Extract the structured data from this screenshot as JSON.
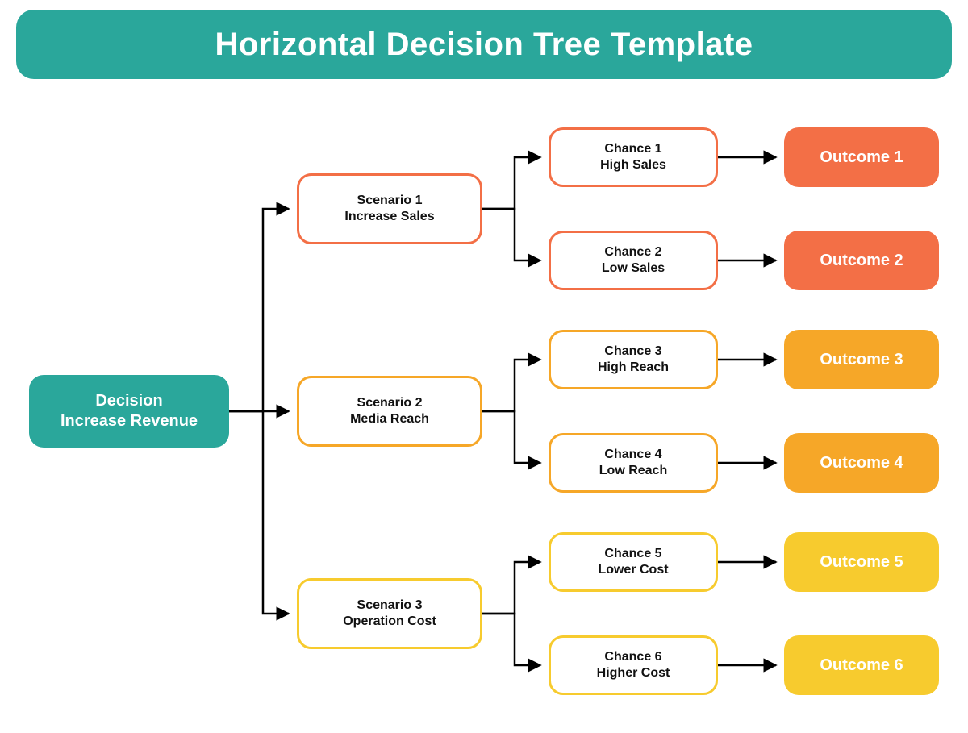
{
  "title": "Horizontal Decision Tree Template",
  "decision": {
    "line1": "Decision",
    "line2": "Increase Revenue"
  },
  "scenarios": [
    {
      "line1": "Scenario 1",
      "line2": "Increase Sales"
    },
    {
      "line1": "Scenario 2",
      "line2": "Media Reach"
    },
    {
      "line1": "Scenario 3",
      "line2": "Operation Cost"
    }
  ],
  "chances": [
    {
      "line1": "Chance 1",
      "line2": "High Sales"
    },
    {
      "line1": "Chance 2",
      "line2": "Low Sales"
    },
    {
      "line1": "Chance 3",
      "line2": "High Reach"
    },
    {
      "line1": "Chance 4",
      "line2": "Low Reach"
    },
    {
      "line1": "Chance 5",
      "line2": "Lower Cost"
    },
    {
      "line1": "Chance 6",
      "line2": "Higher Cost"
    }
  ],
  "outcomes": [
    "Outcome 1",
    "Outcome 2",
    "Outcome 3",
    "Outcome 4",
    "Outcome 5",
    "Outcome 6"
  ],
  "colors": {
    "teal": "#2aa79b",
    "red": "#f36f46",
    "orange": "#f6a728",
    "yellow": "#f7cb2e",
    "line": "#000000"
  }
}
